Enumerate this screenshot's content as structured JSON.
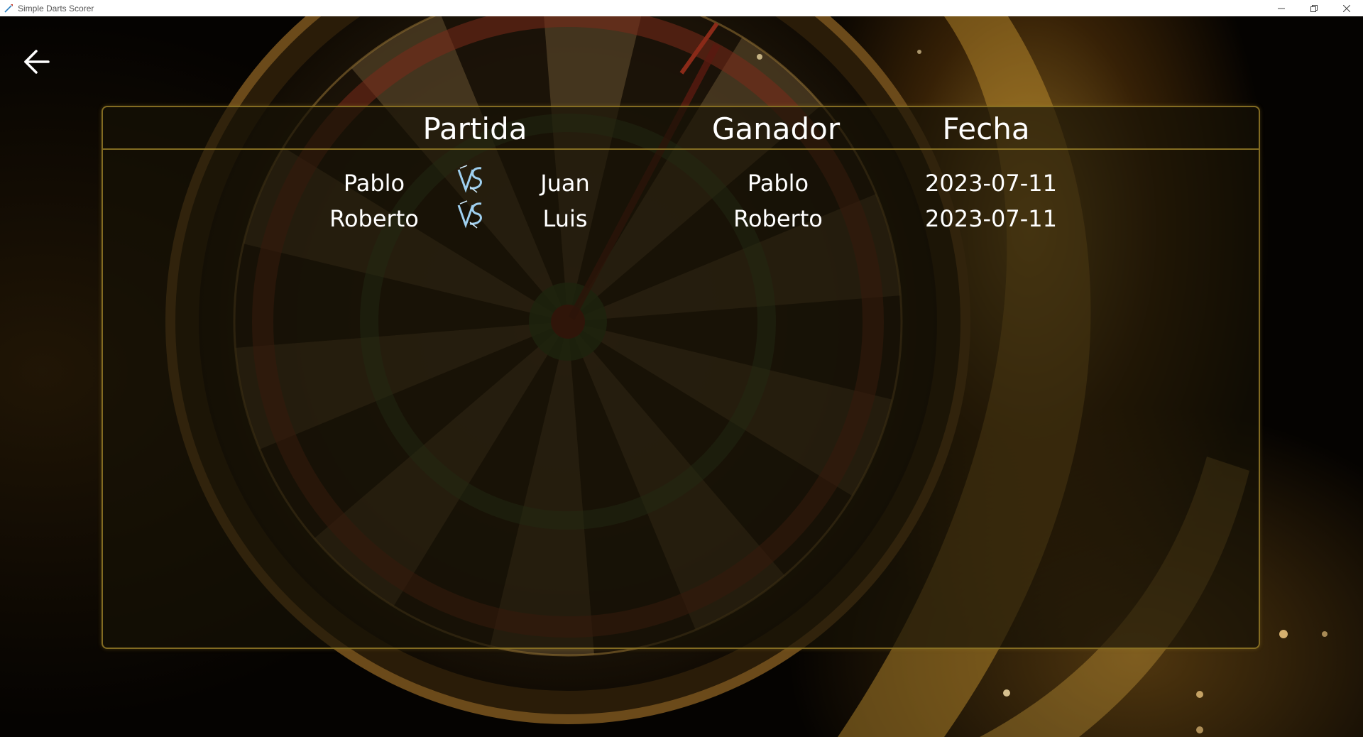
{
  "window": {
    "title": "Simple Darts Scorer"
  },
  "columns": {
    "match": "Partida",
    "winner": "Ganador",
    "date": "Fecha"
  },
  "games": [
    {
      "player1": "Pablo",
      "player2": "Juan",
      "winner": "Pablo",
      "date": "2023-07-11"
    },
    {
      "player1": "Roberto",
      "player2": "Luis",
      "winner": "Roberto",
      "date": "2023-07-11"
    }
  ],
  "colors": {
    "accent": "#967d28",
    "text": "#ffffff",
    "vs_icon": "#9fd0f0"
  },
  "icons": {
    "back": "arrow-left-icon",
    "versus": "vs-icon",
    "app": "dart-icon"
  }
}
